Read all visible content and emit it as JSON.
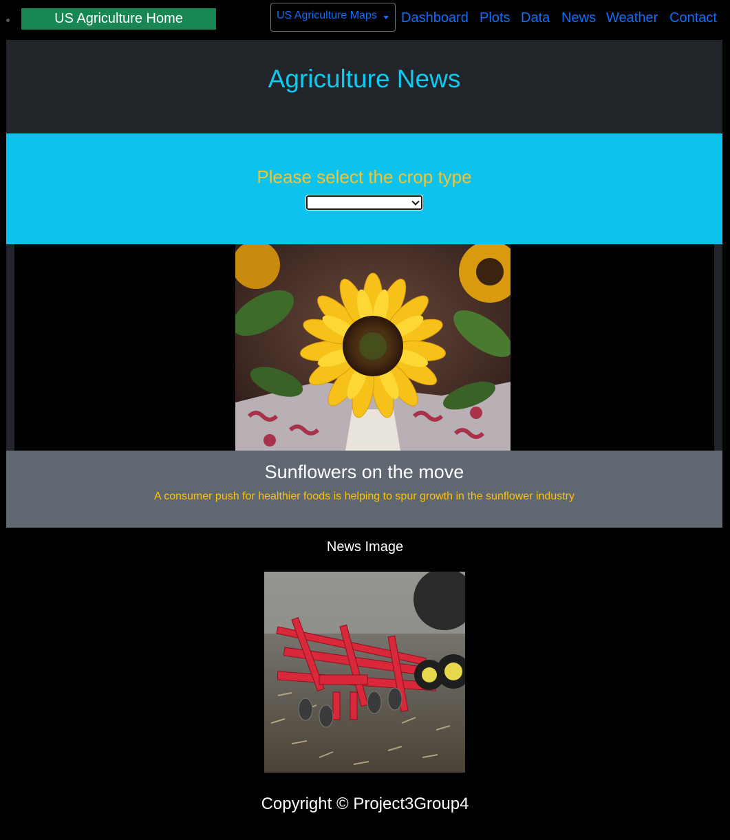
{
  "nav": {
    "home_label": "US Agriculture Home",
    "maps_label": "US Agriculture Maps",
    "links": [
      "Dashboard",
      "Plots",
      "Data",
      "News",
      "Weather",
      "Contact"
    ]
  },
  "page": {
    "title": "Agriculture News"
  },
  "crop_select": {
    "prompt": "Please select the crop type",
    "selected": ""
  },
  "carousel": {
    "caption_title": "Sunflowers on the move",
    "caption_text": "A consumer push for healthier foods is helping to spur growth in the sunflower industry"
  },
  "news_image": {
    "label": "News Image"
  },
  "footer": {
    "copyright": "Copyright © Project3Group4"
  },
  "colors": {
    "home_button": "#198754",
    "link": "#0d6efd",
    "title": "#0dcaf0",
    "select_band": "#0dc3ee",
    "prompt": "#f4c430",
    "caption_band": "#5f6770",
    "caption_text": "#ffc107"
  }
}
